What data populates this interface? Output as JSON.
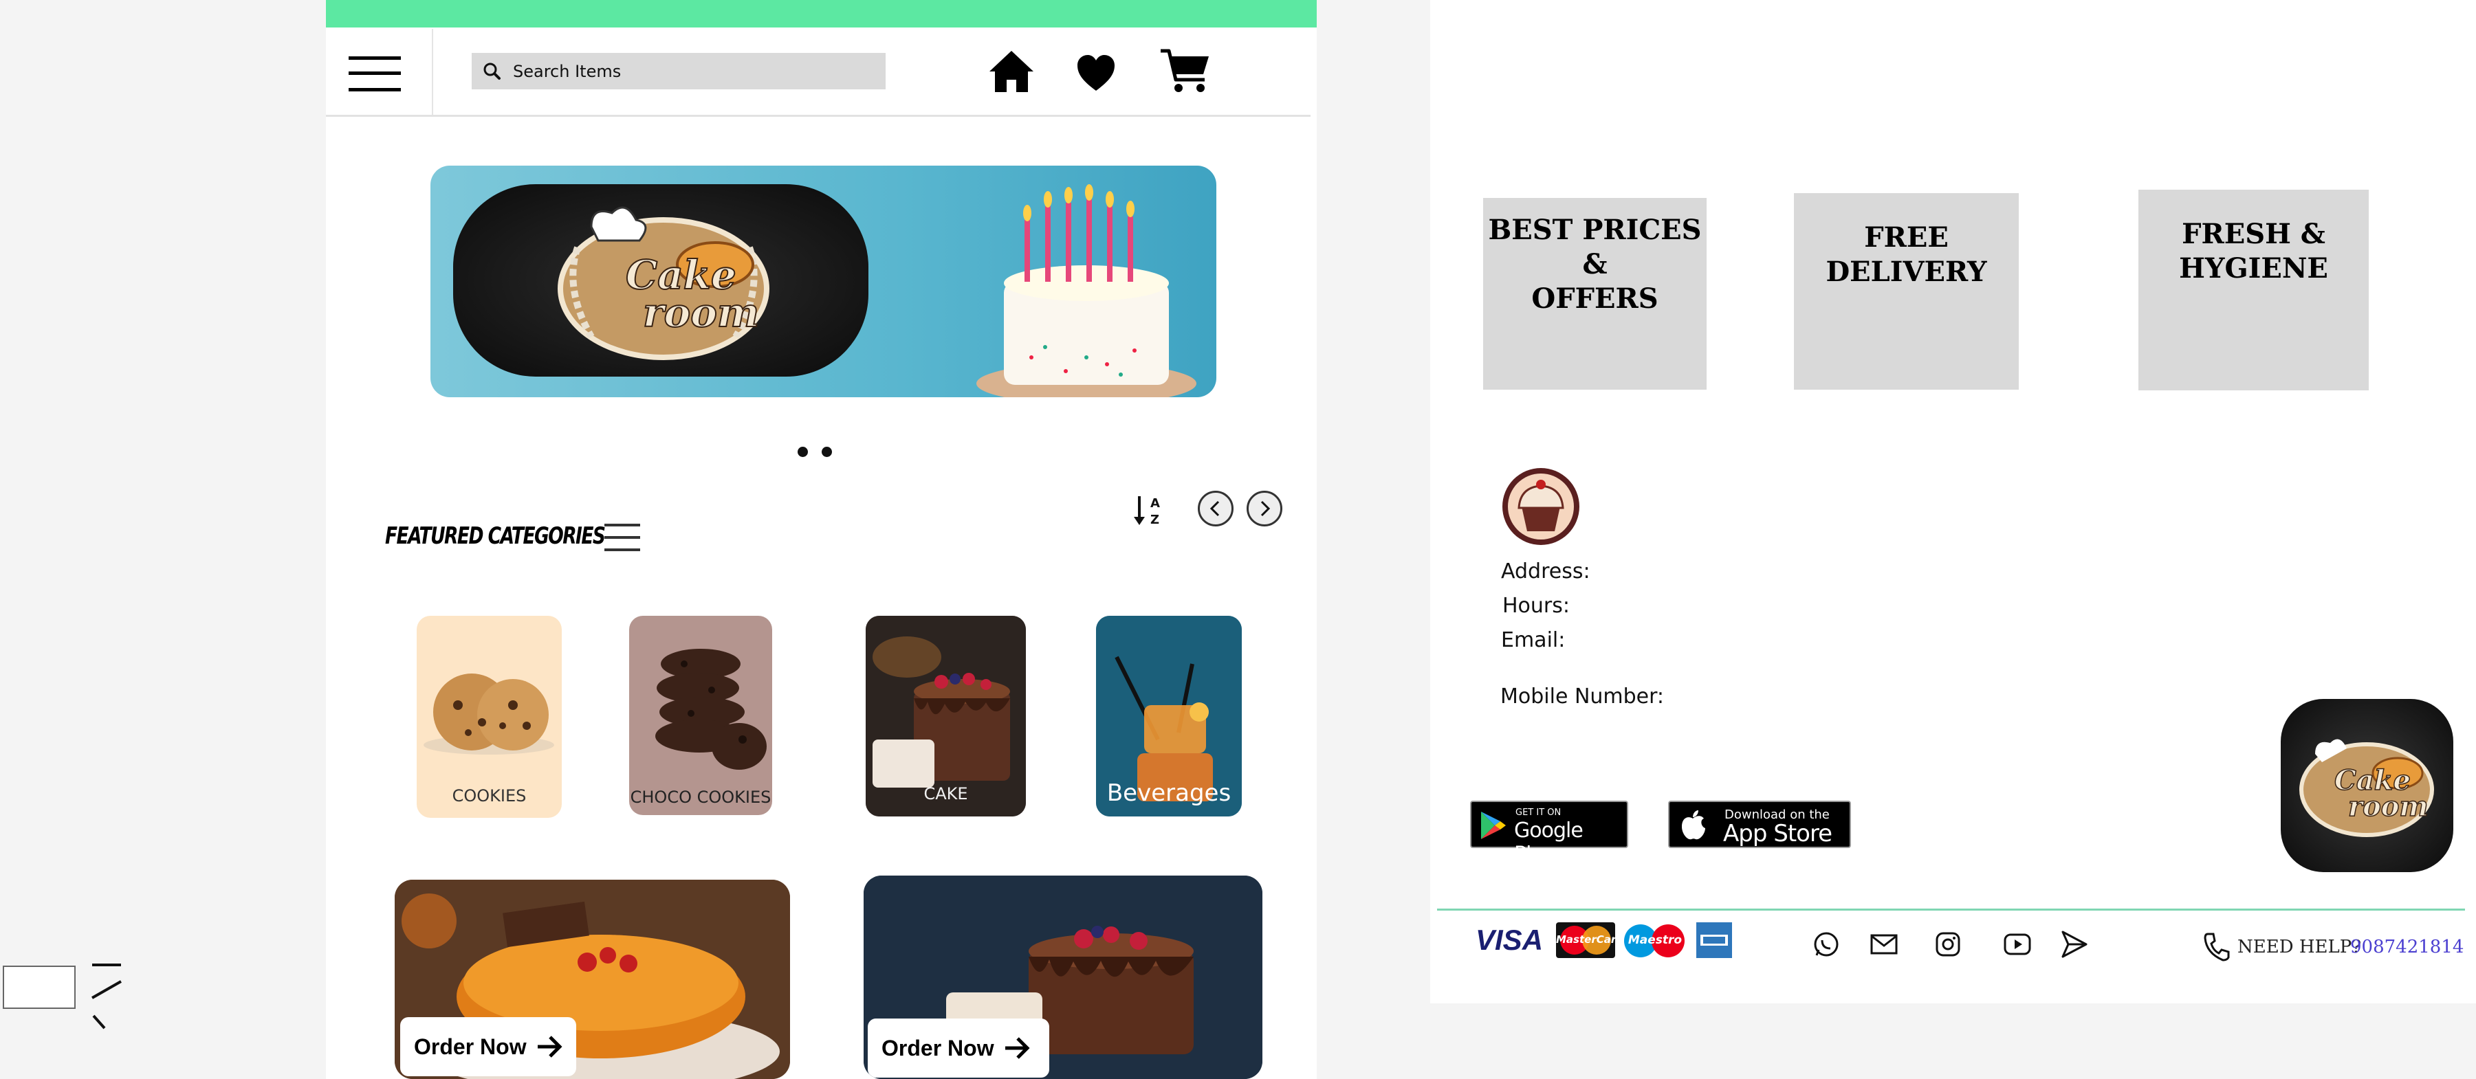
{
  "search": {
    "placeholder": "Search Items"
  },
  "featured": {
    "title": "FEATURED CATEGORIES"
  },
  "categories": [
    {
      "label": "COOKIES"
    },
    {
      "label": "CHOCO COOKIES"
    },
    {
      "label": "CAKE"
    },
    {
      "label": "Beverages"
    }
  ],
  "orders": [
    {
      "label": "Order Now"
    },
    {
      "label": "Order Now"
    }
  ],
  "banner": {
    "logo_line1": "Cake",
    "logo_line2": "room"
  },
  "features": {
    "best": [
      "BEST PRICES",
      "&",
      "OFFERS"
    ],
    "delivery": [
      "FREE",
      "DELIVERY"
    ],
    "fresh": [
      "FRESH &",
      "HYGIENE"
    ]
  },
  "contact": {
    "address": "Address:",
    "hours": "Hours:",
    "email": "Email:",
    "mobile": "Mobile Number:"
  },
  "stores": {
    "gplay_small": "GET IT ON",
    "gplay_big": "Google Play",
    "apple_small": "Download on the",
    "apple_big": "App Store"
  },
  "payments": {
    "visa": "VISA",
    "mastercard": "MasterCard",
    "maestro": "Maestro"
  },
  "help": {
    "label": "NEED HELP?",
    "phone": "9087421814"
  },
  "colors": {
    "accent": "#5ce8a2",
    "feature_bg": "#d9d9d9",
    "help_phone": "#4b3fd0"
  },
  "icons": [
    "menu-icon",
    "search-icon",
    "home-icon",
    "heart-icon",
    "cart-icon",
    "sort-az-icon",
    "chevron-left-icon",
    "chevron-right-icon",
    "whatsapp-icon",
    "mail-icon",
    "instagram-icon",
    "youtube-icon",
    "send-icon",
    "phone-icon"
  ]
}
